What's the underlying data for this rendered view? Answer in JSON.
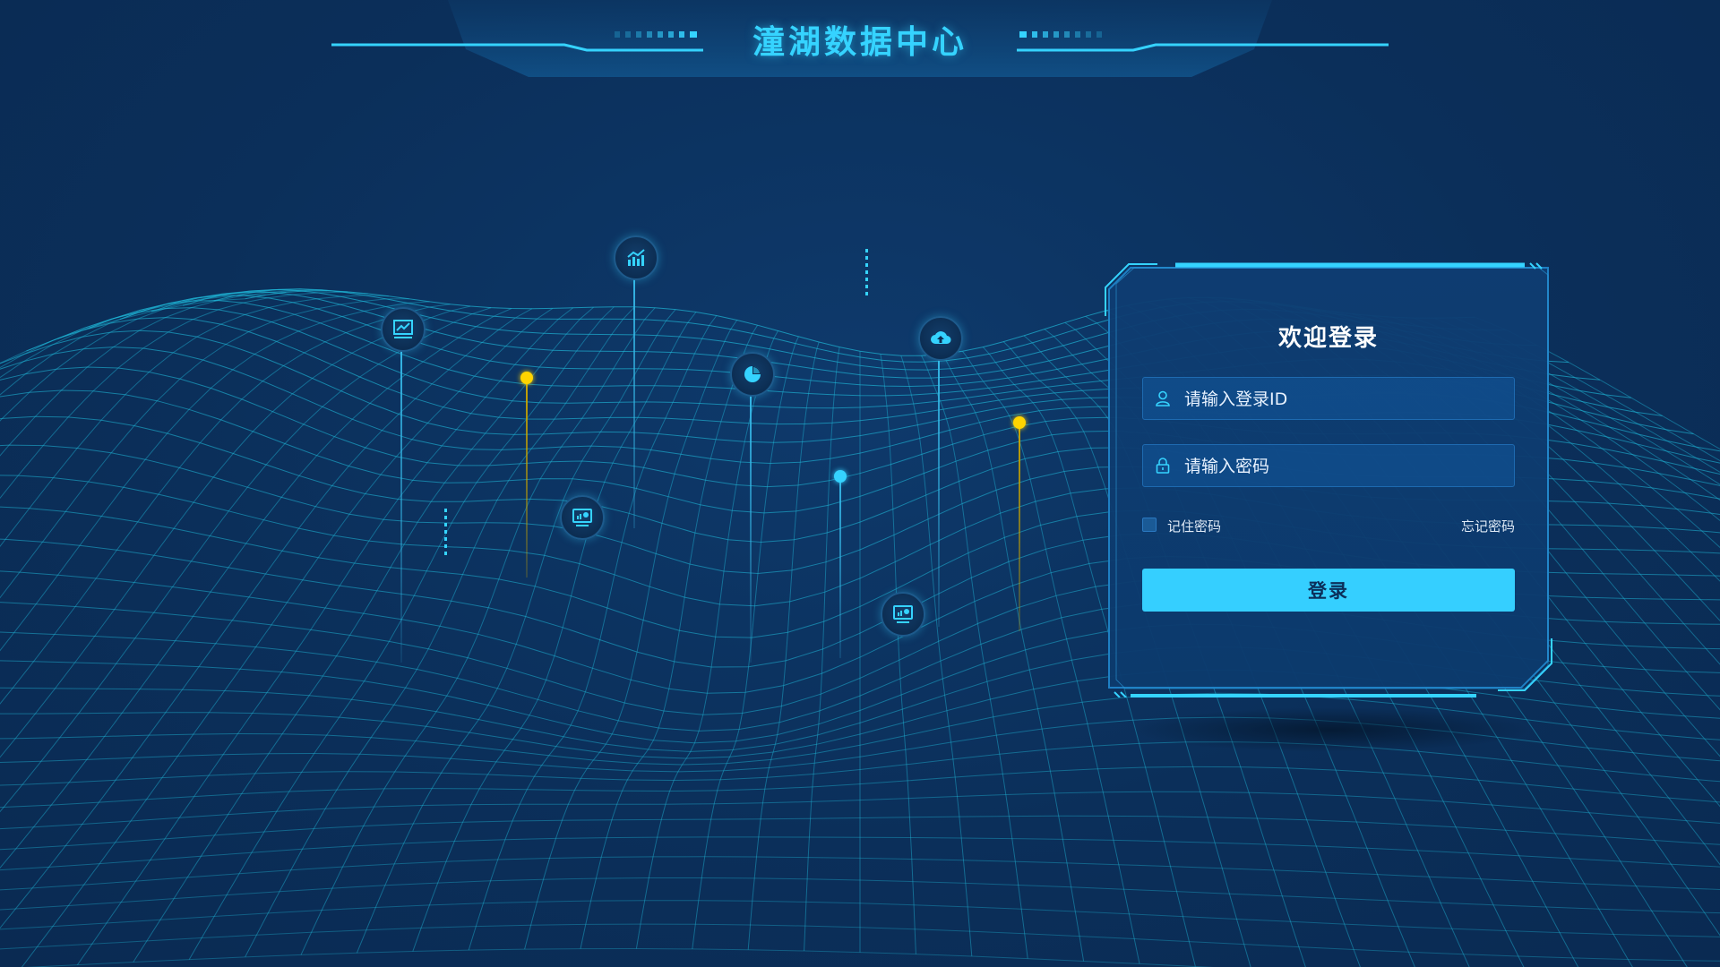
{
  "header": {
    "title": "潼湖数据中心"
  },
  "login": {
    "title": "欢迎登录",
    "username_placeholder": "请输入登录ID",
    "password_placeholder": "请输入密码",
    "remember_label": "记住密码",
    "forgot_label": "忘记密码",
    "submit_label": "登录"
  },
  "icons": {
    "user": "user-icon",
    "lock": "lock-icon",
    "pins": [
      "trend-chart-icon",
      "bar-trend-icon",
      "pie-chart-icon",
      "cloud-upload-icon",
      "monitor-chart-icon",
      "monitor-chart-icon"
    ]
  },
  "colors": {
    "background": "#0b2f5a",
    "accent": "#35d3ff",
    "mesh": "#1fb6d6",
    "pin_yellow": "#ffd400",
    "button": "#35cfff"
  }
}
